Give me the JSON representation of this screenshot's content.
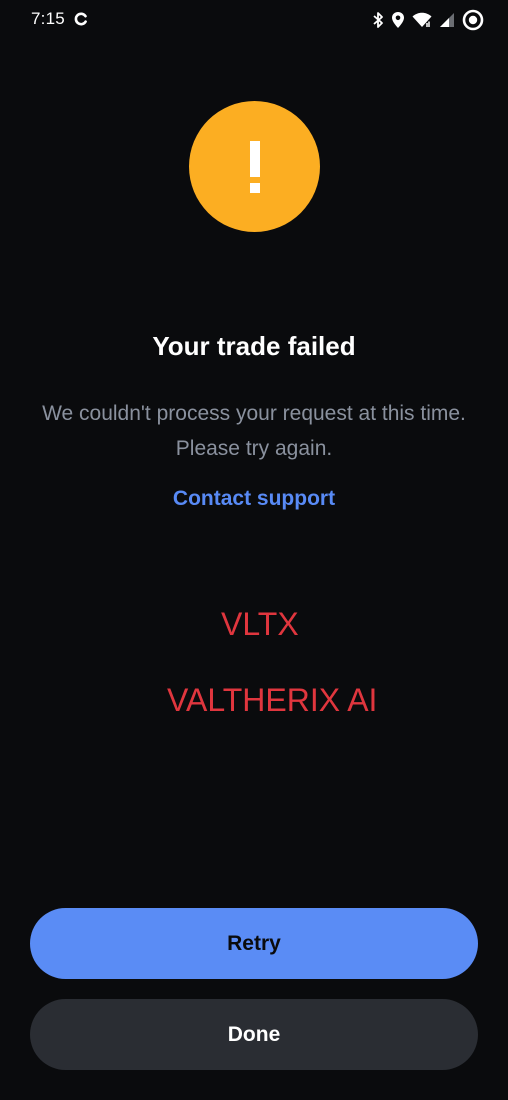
{
  "status_bar": {
    "time": "7:15"
  },
  "alert": {
    "icon": "exclamation-icon",
    "color": "#fcae22"
  },
  "title": "Your trade failed",
  "message": "We couldn't process your request at this time. Please try again.",
  "support_link": "Contact support",
  "overlay": {
    "ticker": "VLTX",
    "name": "VALTHERIX AI",
    "color": "#e0363e"
  },
  "buttons": {
    "retry": "Retry",
    "done": "Done"
  },
  "colors": {
    "background": "#0a0b0d",
    "primary": "#5a8cf5",
    "link": "#588af5",
    "secondary_button": "#2a2d33"
  }
}
